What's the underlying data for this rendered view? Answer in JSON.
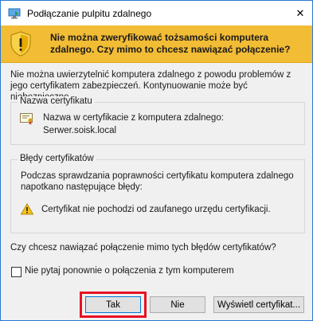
{
  "window": {
    "title": "Podłączanie pulpitu zdalnego",
    "close_symbol": "✕"
  },
  "warning": {
    "headline": "Nie można zweryfikować tożsamości komputera zdalnego. Czy mimo to chcesz nawiązać połączenie?",
    "icon": "warning-shield-icon"
  },
  "intro": "Nie można uwierzytelnić komputera zdalnego z powodu problemów z jego certyfikatem zabezpieczeń. Kontynuowanie może być niebezpieczne.",
  "certificate_group": {
    "legend": "Nazwa certyfikatu",
    "line1": "Nazwa w certyfikacie z komputera zdalnego:",
    "line2": "Serwer.soisk.local",
    "icon": "certificate-icon"
  },
  "errors_group": {
    "legend": "Błędy certyfikatów",
    "description": "Podczas sprawdzania poprawności certyfikatu komputera zdalnego napotkano następujące błędy:",
    "items": [
      "Certyfikat nie pochodzi od zaufanego urzędu certyfikacji."
    ],
    "icon": "warning-triangle-icon"
  },
  "question": "Czy chcesz nawiązać połączenie mimo tych błędów certyfikatów?",
  "checkbox": {
    "label": "Nie pytaj ponownie o połączenia z tym komputerem",
    "checked": false
  },
  "buttons": {
    "yes": "Tak",
    "no": "Nie",
    "view": "Wyświetl certyfikat..."
  },
  "colors": {
    "warning_band": "#f2bc35",
    "highlight": "#e81123",
    "focus": "#0078d7"
  }
}
